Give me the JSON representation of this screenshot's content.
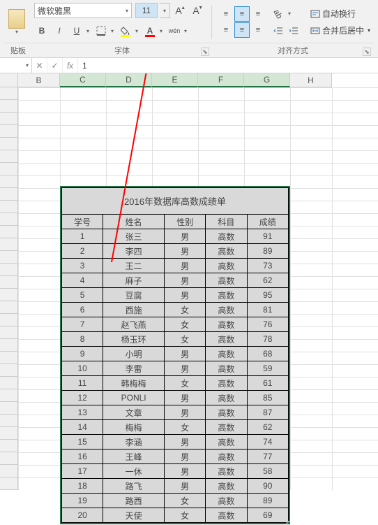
{
  "ribbon": {
    "font_name": "微软雅黑",
    "font_size": "11",
    "bold": "B",
    "italic": "I",
    "underline": "U",
    "wen": "wén",
    "increase_font": "A",
    "decrease_font": "A",
    "wrap_text": "自动换行",
    "merge_center": "合并后居中",
    "group_clipboard": "贴板",
    "group_font": "字体",
    "group_align": "对齐方式"
  },
  "formula_bar": {
    "fx": "fx",
    "value": "1"
  },
  "columns": [
    "B",
    "C",
    "D",
    "E",
    "F",
    "G",
    "H"
  ],
  "table": {
    "title": "2016年数据库高数成绩单",
    "headers": [
      "学号",
      "姓名",
      "性别",
      "科目",
      "成绩"
    ],
    "rows": [
      [
        "1",
        "张三",
        "男",
        "高数",
        "91"
      ],
      [
        "2",
        "李四",
        "男",
        "高数",
        "89"
      ],
      [
        "3",
        "王二",
        "男",
        "高数",
        "73"
      ],
      [
        "4",
        "麻子",
        "男",
        "高数",
        "62"
      ],
      [
        "5",
        "豆腐",
        "男",
        "高数",
        "95"
      ],
      [
        "6",
        "西施",
        "女",
        "高数",
        "81"
      ],
      [
        "7",
        "赵飞燕",
        "女",
        "高数",
        "76"
      ],
      [
        "8",
        "杨玉环",
        "女",
        "高数",
        "78"
      ],
      [
        "9",
        "小明",
        "男",
        "高数",
        "68"
      ],
      [
        "10",
        "李雷",
        "男",
        "高数",
        "59"
      ],
      [
        "11",
        "韩梅梅",
        "女",
        "高数",
        "61"
      ],
      [
        "12",
        "PONLI",
        "男",
        "高数",
        "85"
      ],
      [
        "13",
        "文章",
        "男",
        "高数",
        "87"
      ],
      [
        "14",
        "梅梅",
        "女",
        "高数",
        "62"
      ],
      [
        "15",
        "李涵",
        "男",
        "高数",
        "74"
      ],
      [
        "16",
        "王峰",
        "男",
        "高数",
        "77"
      ],
      [
        "17",
        "一休",
        "男",
        "高数",
        "58"
      ],
      [
        "18",
        "路飞",
        "男",
        "高数",
        "90"
      ],
      [
        "19",
        "路西",
        "女",
        "高数",
        "89"
      ],
      [
        "20",
        "天使",
        "女",
        "高数",
        "69"
      ]
    ]
  },
  "chart_data": {
    "type": "table",
    "title": "2016年数据库高数成绩单",
    "columns": [
      "学号",
      "姓名",
      "性别",
      "科目",
      "成绩"
    ],
    "rows": [
      [
        1,
        "张三",
        "男",
        "高数",
        91
      ],
      [
        2,
        "李四",
        "男",
        "高数",
        89
      ],
      [
        3,
        "王二",
        "男",
        "高数",
        73
      ],
      [
        4,
        "麻子",
        "男",
        "高数",
        62
      ],
      [
        5,
        "豆腐",
        "男",
        "高数",
        95
      ],
      [
        6,
        "西施",
        "女",
        "高数",
        81
      ],
      [
        7,
        "赵飞燕",
        "女",
        "高数",
        76
      ],
      [
        8,
        "杨玉环",
        "女",
        "高数",
        78
      ],
      [
        9,
        "小明",
        "男",
        "高数",
        68
      ],
      [
        10,
        "李雷",
        "男",
        "高数",
        59
      ],
      [
        11,
        "韩梅梅",
        "女",
        "高数",
        61
      ],
      [
        12,
        "PONLI",
        "男",
        "高数",
        85
      ],
      [
        13,
        "文章",
        "男",
        "高数",
        87
      ],
      [
        14,
        "梅梅",
        "女",
        "高数",
        62
      ],
      [
        15,
        "李涵",
        "男",
        "高数",
        74
      ],
      [
        16,
        "王峰",
        "男",
        "高数",
        77
      ],
      [
        17,
        "一休",
        "男",
        "高数",
        58
      ],
      [
        18,
        "路飞",
        "男",
        "高数",
        90
      ],
      [
        19,
        "路西",
        "女",
        "高数",
        89
      ],
      [
        20,
        "天使",
        "女",
        "高数",
        69
      ]
    ]
  }
}
